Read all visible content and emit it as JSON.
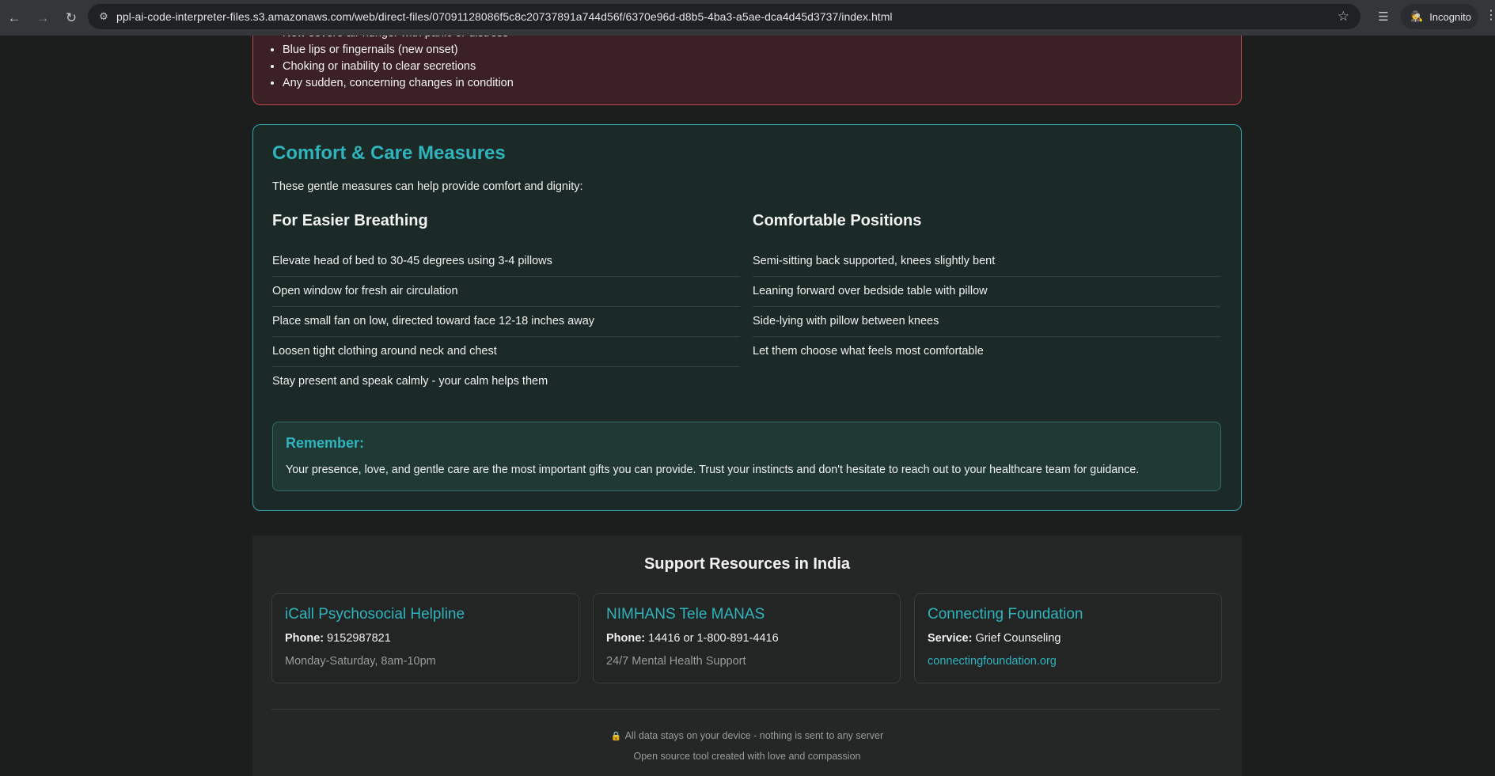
{
  "browser": {
    "url": "ppl-ai-code-interpreter-files.s3.amazonaws.com/web/direct-files/07091128086f5c8c20737891a744d56f/6370e96d-d8b5-4ba3-a5ae-dca4d45d3737/index.html",
    "profile_label": "Incognito"
  },
  "warning": {
    "items": [
      "New severe air hunger with panic or distress",
      "Blue lips or fingernails (new onset)",
      "Choking or inability to clear secretions",
      "Any sudden, concerning changes in condition"
    ]
  },
  "comfort": {
    "title": "Comfort & Care Measures",
    "intro": "These gentle measures can help provide comfort and dignity:",
    "breathing": {
      "heading": "For Easier Breathing",
      "items": [
        "Elevate head of bed to 30-45 degrees using 3-4 pillows",
        "Open window for fresh air circulation",
        "Place small fan on low, directed toward face 12-18 inches away",
        "Loosen tight clothing around neck and chest",
        "Stay present and speak calmly - your calm helps them"
      ]
    },
    "positions": {
      "heading": "Comfortable Positions",
      "items": [
        "Semi-sitting back supported, knees slightly bent",
        "Leaning forward over bedside table with pillow",
        "Side-lying with pillow between knees",
        "Let them choose what feels most comfortable"
      ]
    },
    "remember": {
      "title": "Remember:",
      "text": "Your presence, love, and gentle care are the most important gifts you can provide. Trust your instincts and don't hesitate to reach out to your healthcare team for guidance."
    }
  },
  "resources": {
    "heading": "Support Resources in India",
    "cards": [
      {
        "title": "iCall Psychosocial Helpline",
        "label": "Phone:",
        "value": "9152987821",
        "sub": "Monday-Saturday, 8am-10pm"
      },
      {
        "title": "NIMHANS Tele MANAS",
        "label": "Phone:",
        "value": "14416 or 1-800-891-4416",
        "sub": "24/7 Mental Health Support"
      },
      {
        "title": "Connecting Foundation",
        "label": "Service:",
        "value": "Grief Counseling",
        "link": "connectingfoundation.org"
      }
    ],
    "footer_privacy": "All data stays on your device - nothing is sent to any server",
    "footer_credit": "Open source tool created with love and compassion"
  },
  "colors": {
    "accent_teal": "#2fb4bd",
    "warning_border": "#c0454d",
    "privacy_lock": "#d7a44a"
  }
}
